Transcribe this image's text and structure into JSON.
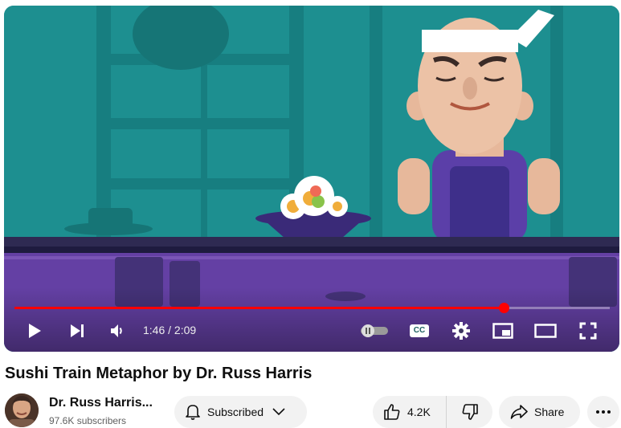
{
  "player": {
    "current_time": "1:46",
    "duration": "2:09",
    "time_display": "1:46 / 2:09",
    "progress_fraction": 0.8217,
    "accent_color": "#ff0000",
    "captions_label": "CC",
    "icons": [
      "play-icon",
      "next-icon",
      "volume-icon",
      "autoplay-toggle-icon",
      "captions-icon",
      "settings-gear-icon",
      "miniplayer-icon",
      "theater-mode-icon",
      "fullscreen-icon"
    ]
  },
  "video": {
    "title": "Sushi Train Metaphor by Dr. Russ Harris"
  },
  "channel": {
    "name": "Dr. Russ Harris...",
    "subscribers": "97.6K subscribers"
  },
  "actions": {
    "subscribe_label": "Subscribed",
    "like_count": "4.2K",
    "share_label": "Share"
  }
}
